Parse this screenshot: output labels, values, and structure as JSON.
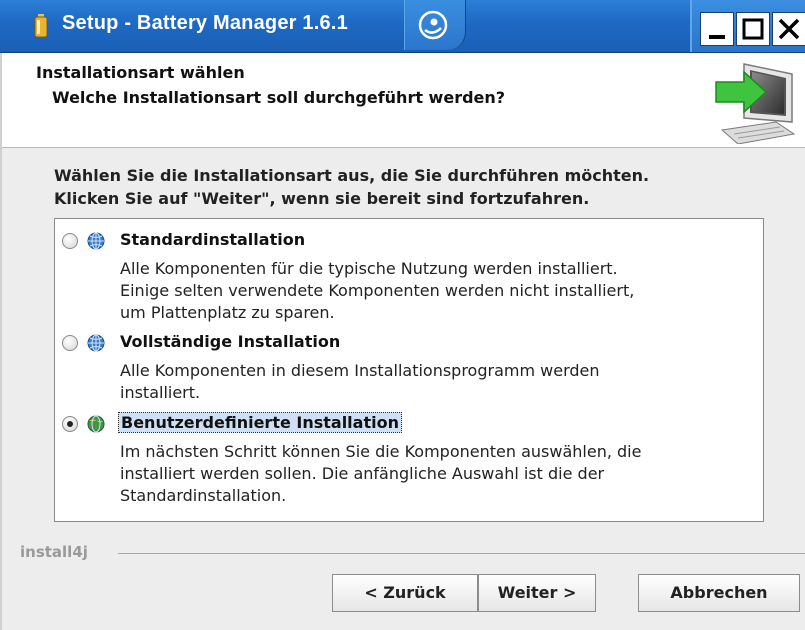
{
  "window": {
    "title": "Setup - Battery Manager 1.6.1",
    "minimize_icon": "minimize-icon",
    "maximize_icon": "maximize-icon",
    "close_icon": "close-icon"
  },
  "header": {
    "title": "Installationsart wählen",
    "subtitle": "Welche Installationsart soll durchgeführt werden?"
  },
  "instructions": {
    "line1": "Wählen Sie die Installationsart aus, die Sie durchführen möchten.",
    "line2": "Klicken Sie auf \"Weiter\", wenn sie bereit sind fortzufahren."
  },
  "options": [
    {
      "label": "Standardinstallation",
      "selected": false,
      "description": [
        "Alle Komponenten für die typische Nutzung werden installiert.",
        "Einige selten verwendete Komponenten werden nicht installiert,",
        "um Plattenplatz zu sparen."
      ]
    },
    {
      "label": "Vollständige Installation",
      "selected": false,
      "description": [
        "Alle Komponenten in diesem Installationsprogramm werden",
        "installiert."
      ]
    },
    {
      "label": "Benutzerdefinierte Installation",
      "selected": true,
      "description": [
        "Im nächsten Schritt können Sie die Komponenten auswählen, die",
        "installiert werden sollen. Die anfängliche Auswahl ist die der",
        "Standardinstallation."
      ]
    }
  ],
  "footer": {
    "brand": "install4j",
    "back_label": "< Zurück",
    "next_label": "Weiter >",
    "cancel_label": "Abbrechen"
  },
  "colors": {
    "titlebar": "#1f6ac4",
    "focus_highlight": "#cfe0f5"
  }
}
